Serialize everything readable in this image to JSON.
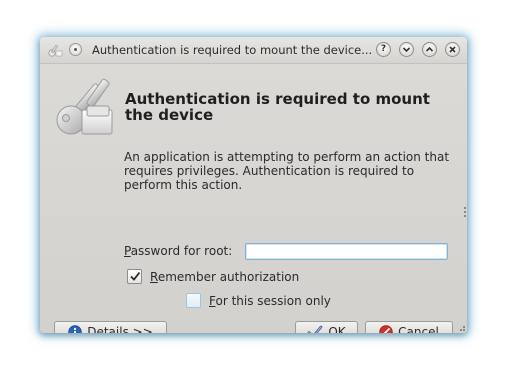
{
  "window": {
    "title": "Authentication is required to mount the device...",
    "accent_glow": "#3c96c8"
  },
  "titlebar_buttons": {
    "help": "?",
    "minimize": "⌄",
    "maximize": "⌃",
    "close": "✕"
  },
  "dialog": {
    "heading": "Authentication is required to mount the device",
    "description": "An application is attempting to perform an action that requires privileges. Authentication is required to perform this action.",
    "password_label_mnemonic": "P",
    "password_label_rest": "assword for root:",
    "password_value": "",
    "remember": {
      "checked": true,
      "mnemonic": "R",
      "label_rest": "emember authorization"
    },
    "session_only": {
      "checked": false,
      "mnemonic": "F",
      "label_rest": "or this session only"
    }
  },
  "buttons": {
    "details_mnemonic": "D",
    "details_rest": "etails >>",
    "ok_mnemonic": "O",
    "ok_rest": "K",
    "cancel_mnemonic": "C",
    "cancel_rest": "ancel"
  },
  "icons": {
    "app": "keys-app-icon",
    "menu": "window-menu-icon",
    "dialog": "keys-icon",
    "details": "info-icon",
    "ok": "checkmark-icon",
    "cancel": "cancel-icon"
  }
}
